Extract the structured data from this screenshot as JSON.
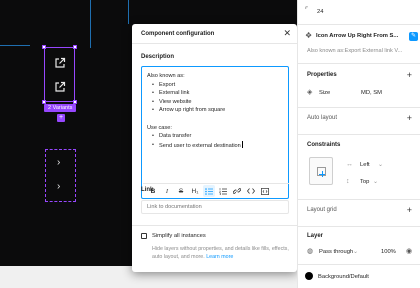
{
  "dialog": {
    "title": "Component configuration",
    "close_icon": "close-icon",
    "description_label": "Description",
    "description": {
      "aka_heading": "Also known as:",
      "aka_items": [
        "Export",
        "External link",
        "View website",
        "Arrow up right from square"
      ],
      "use_heading": "Use case:",
      "use_items": [
        "Data transfer",
        "Send user to external destination"
      ]
    },
    "toolbar": {
      "bold": "B",
      "italic": "I",
      "strike": "S",
      "heading": "H₁",
      "icons": [
        "bold-icon",
        "italic-icon",
        "strikethrough-icon",
        "heading-icon",
        "bulleted-list-icon",
        "numbered-list-icon",
        "link-icon",
        "code-icon",
        "code-block-icon"
      ]
    },
    "link_label": "Link",
    "link_placeholder": "Link to documentation",
    "simplify_label": "Simplify all instances",
    "simplify_help": "Hide layers without properties, and details like fills, effects, auto layout, and more.",
    "learn_more": "Learn more"
  },
  "canvas": {
    "variants_badge": "2 Variants",
    "add_variant": "+"
  },
  "panel": {
    "top_value": "24",
    "component_name": "Icon Arrow Up Right From S...",
    "aka_text": "Also known as:Export External link V...",
    "properties_title": "Properties",
    "size_label": "Size",
    "size_value": "MD, SM",
    "auto_layout_title": "Auto layout",
    "constraints_title": "Constraints",
    "left_value": "Left",
    "top_constraint": "Top",
    "layout_grid_title": "Layout grid",
    "layer_title": "Layer",
    "pass_through": "Pass through",
    "opacity": "100%",
    "fill_name": "Background/Default"
  }
}
